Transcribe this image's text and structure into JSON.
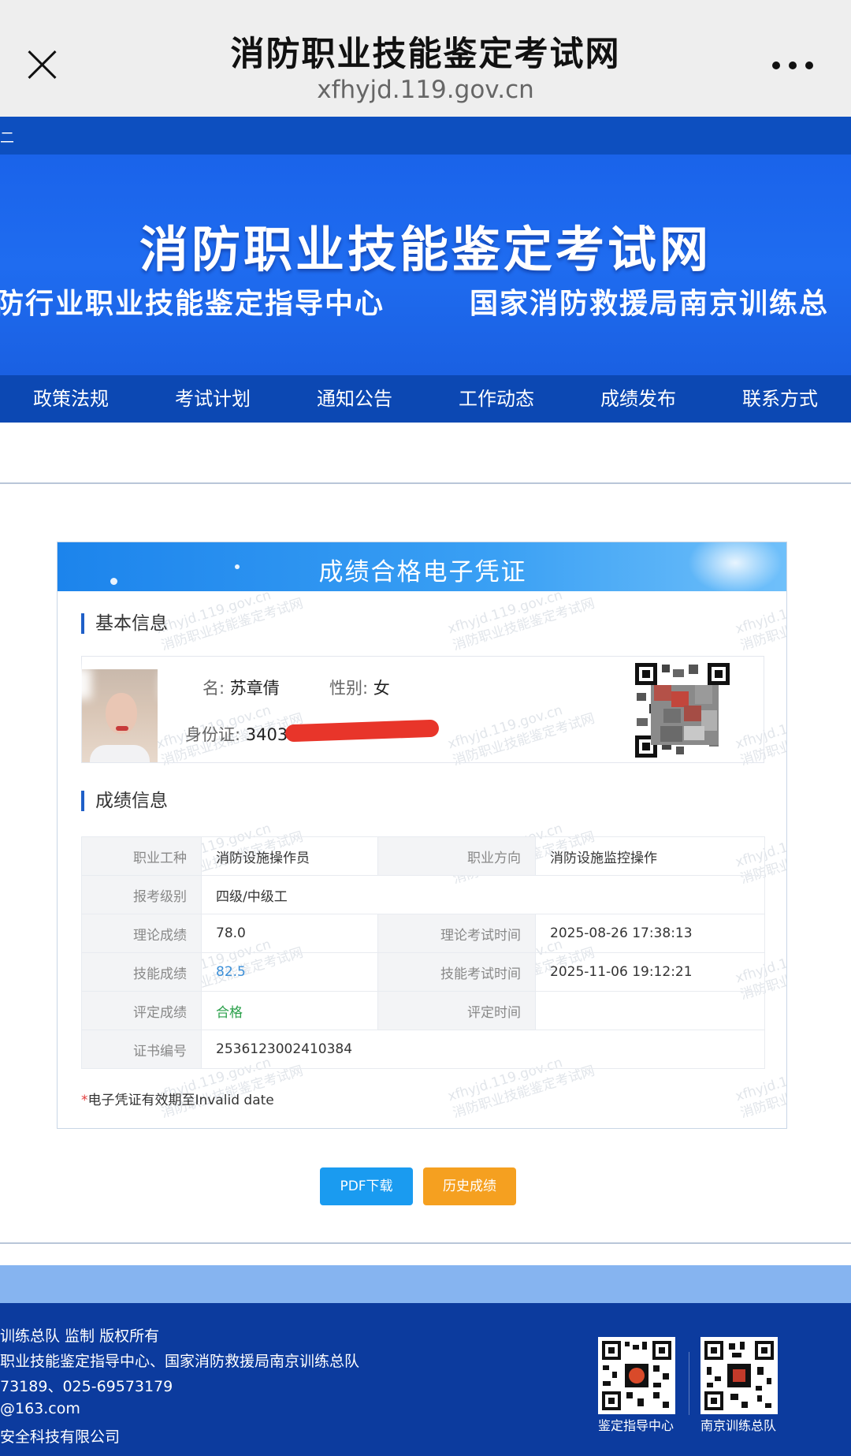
{
  "browser": {
    "title": "消防职业技能鉴定考试网",
    "url": "xfhyjd.119.gov.cn"
  },
  "header": {
    "strip_mark": "二",
    "banner_title": "消防职业技能鉴定考试网",
    "banner_sub_left": "防行业职业技能鉴定指导中心",
    "banner_sub_right": "国家消防救援局南京训练总"
  },
  "nav": [
    "政策法规",
    "考试计划",
    "通知公告",
    "工作动态",
    "成绩发布",
    "联系方式"
  ],
  "certificate": {
    "title": "成绩合格电子凭证",
    "watermark_line1": "xfhyjd.119.gov.cn",
    "watermark_line2": "消防职业技能鉴定考试网",
    "basic_section": "基本信息",
    "name_label": "名:",
    "name_value": "苏章倩",
    "gender_label": "性别:",
    "gender_value": "女",
    "id_label": "身份证:",
    "id_value": "3403",
    "grade_section": "成绩信息",
    "rows": [
      {
        "l1": "职业工种",
        "v1": "消防设施操作员",
        "l2": "职业方向",
        "v2": "消防设施监控操作"
      },
      {
        "l1": "报考级别",
        "v1": "四级/中级工"
      },
      {
        "l1": "理论成绩",
        "v1": "78.0",
        "l2": "理论考试时间",
        "v2": "2025-08-26 17:38:13"
      },
      {
        "l1": "技能成绩",
        "v1": "82.5",
        "l2": "技能考试时间",
        "v2": "2025-11-06 19:12:21"
      },
      {
        "l1": "评定成绩",
        "v1": "合格",
        "l2": "评定时间",
        "v2": ""
      },
      {
        "l1": "证书编号",
        "v1": "2536123002410384"
      }
    ],
    "validity_star": "*",
    "validity_text": "电子凭证有效期至Invalid date"
  },
  "buttons": {
    "pdf": "PDF下载",
    "history": "历史成绩"
  },
  "footer": {
    "lines": [
      "训练总队 监制 版权所有",
      "职业技能鉴定指导中心、国家消防救援局南京训练总队",
      "73189、025-69573179",
      "@163.com",
      "安全科技有限公司"
    ],
    "qr1_label": "鉴定指导中心",
    "qr2_label": "南京训练总队"
  },
  "colors": {
    "brand_blue": "#1a63ea",
    "nav_blue": "#0c48b3",
    "footer_blue": "#0c3b9e",
    "pdf_button": "#1a9bf0",
    "history_button": "#f5a020",
    "pass_green": "#2aa04a"
  }
}
